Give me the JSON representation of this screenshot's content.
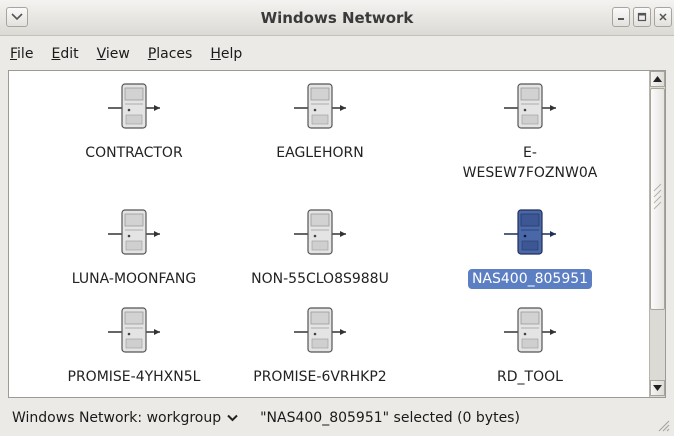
{
  "window": {
    "title": "Windows Network"
  },
  "menubar": {
    "items": [
      {
        "label": "File",
        "mnemonic": "F",
        "rest": "ile"
      },
      {
        "label": "Edit",
        "mnemonic": "E",
        "rest": "dit"
      },
      {
        "label": "View",
        "mnemonic": "V",
        "rest": "iew"
      },
      {
        "label": "Places",
        "mnemonic": "P",
        "rest": "laces"
      },
      {
        "label": "Help",
        "mnemonic": "H",
        "rest": "elp"
      }
    ]
  },
  "hosts": [
    {
      "label": "CONTRACTOR",
      "selected": false,
      "icon": "server-icon"
    },
    {
      "label": "EAGLEHORN",
      "selected": false,
      "icon": "server-icon"
    },
    {
      "label_line1": "E-",
      "label_line2": "WESEW7FOZNW0A",
      "selected": false,
      "icon": "server-icon"
    },
    {
      "label": "LUNA-MOONFANG",
      "selected": false,
      "icon": "server-icon"
    },
    {
      "label": "NON-55CLO8S988U",
      "selected": false,
      "icon": "server-icon"
    },
    {
      "label": "NAS400_805951",
      "selected": true,
      "icon": "server-icon"
    },
    {
      "label": "PROMISE-4YHXN5L",
      "selected": false,
      "icon": "server-icon"
    },
    {
      "label": "PROMISE-6VRHKP2",
      "selected": false,
      "icon": "server-icon"
    },
    {
      "label": "RD_TOOL",
      "selected": false,
      "icon": "server-icon"
    }
  ],
  "statusbar": {
    "location": "Windows Network: workgroup",
    "selection": "\"NAS400_805951\" selected (0 bytes)"
  },
  "colors": {
    "selection": "#5c7ec2",
    "content_bg": "#ffffff",
    "chrome_bg": "#eceae6"
  }
}
